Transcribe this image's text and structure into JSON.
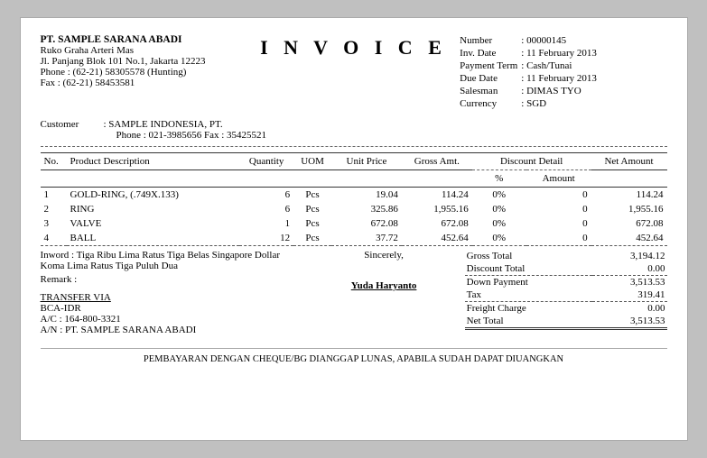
{
  "company": {
    "name": "PT. SAMPLE SARANA ABADI",
    "address1": "Ruko Graha Arteri Mas",
    "address2": "Jl. Panjang Blok 101 No.1, Jakarta 12223",
    "phone": "Phone  :  (62-21) 58305578 (Hunting)",
    "fax": "Fax      :  (62-21) 58453581"
  },
  "title": "I N V O I C E",
  "invoiceDetails": {
    "numberLabel": "Number",
    "numberValue": ": 00000145",
    "invDateLabel": "Inv. Date",
    "invDateValue": ": 11 February 2013",
    "paymentTermLabel": "Payment Term",
    "paymentTermValue": ": Cash/Tunai",
    "dueDateLabel": "Due Date",
    "dueDateValue": ": 11 February 2013",
    "salesmanLabel": "Salesman",
    "salesmanValue": ": DIMAS TYO",
    "currencyLabel": "Currency",
    "currencyValue": ": SGD"
  },
  "customer": {
    "label": "Customer",
    "name": ": SAMPLE  INDONESIA, PT.",
    "contact": "Phone : 021-3985656   Fax : 35425521"
  },
  "tableHeaders": {
    "no": "No.",
    "productDesc": "Product Description",
    "quantity": "Quantity",
    "uom": "UOM",
    "unitPrice": "Unit Price",
    "grossAmt": "Gross Amt.",
    "discountDetail": "Discount Detail",
    "discountPct": "%",
    "discountAmt": "Amount",
    "netAmount": "Net Amount"
  },
  "items": [
    {
      "no": "1",
      "desc": "GOLD-RING, (.749X.133)",
      "qty": "6",
      "uom": "Pcs",
      "unitPrice": "19.04",
      "grossAmt": "114.24",
      "discPct": "0%",
      "discAmt": "0",
      "netAmt": "114.24"
    },
    {
      "no": "2",
      "desc": "RING",
      "qty": "6",
      "uom": "Pcs",
      "unitPrice": "325.86",
      "grossAmt": "1,955.16",
      "discPct": "0%",
      "discAmt": "0",
      "netAmt": "1,955.16"
    },
    {
      "no": "3",
      "desc": "VALVE",
      "qty": "1",
      "uom": "Pcs",
      "unitPrice": "672.08",
      "grossAmt": "672.08",
      "discPct": "0%",
      "discAmt": "0",
      "netAmt": "672.08"
    },
    {
      "no": "4",
      "desc": "BALL",
      "qty": "12",
      "uom": "Pcs",
      "unitPrice": "37.72",
      "grossAmt": "452.64",
      "discPct": "0%",
      "discAmt": "0",
      "netAmt": "452.64"
    }
  ],
  "inword": "Tiga Ribu Lima Ratus Tiga Belas Singapore Dollar Koma Lima Ratus Tiga Puluh Dua",
  "sincerely": "Sincerely,",
  "signature": "Yuda  Haryanto",
  "remark": "Remark :",
  "transfer": {
    "label": "TRANSFER VIA",
    "bank": "BCA-IDR",
    "account": "A/C : 164-800-3321",
    "accountName": "A/N : PT. SAMPLE SARANA ABADI"
  },
  "totals": {
    "grossTotalLabel": "Gross Total",
    "grossTotalValue": "3,194.12",
    "discountTotalLabel": "Discount Total",
    "discountTotalValue": "0.00",
    "downPaymentLabel": "Down Payment",
    "downPaymentValue": "3,513.53",
    "taxLabel": "Tax",
    "taxValue": "319.41",
    "freightLabel": "Freight Charge",
    "freightValue": "0.00",
    "netTotalLabel": "Net Total",
    "netTotalValue": "3,513.53"
  },
  "footerNote": "PEMBAYARAN DENGAN CHEQUE/BG DIANGGAP LUNAS, APABILA SUDAH DAPAT DIUANGKAN"
}
